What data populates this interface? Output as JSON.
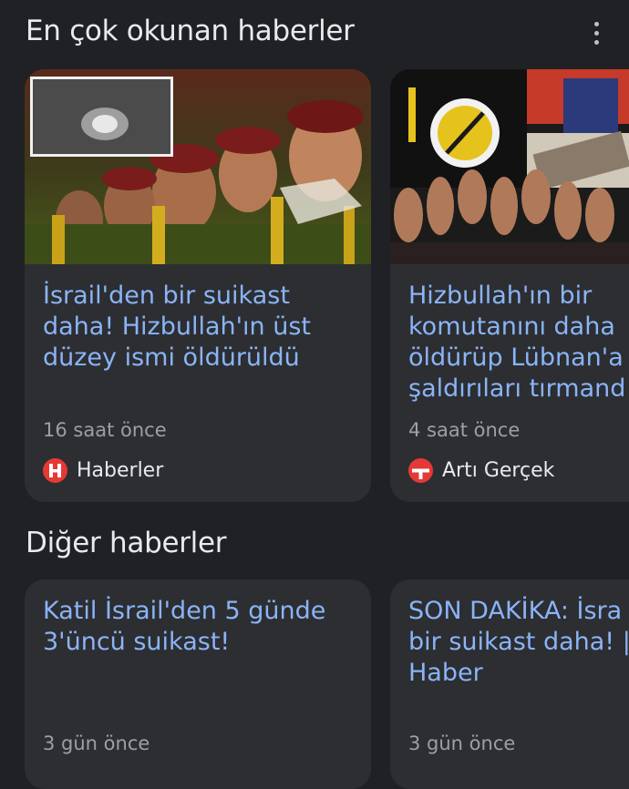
{
  "sections": {
    "top_news_title": "En çok okunan haberler",
    "other_news_title": "Diğer haberler"
  },
  "top_cards": [
    {
      "title": "İsrail'den bir suikast\ndaha! Hizbullah'ın üst\ndüzey ismi öldürüldü",
      "time": "16 saat önce",
      "source": "Haberler",
      "source_icon": "haberler-logo-icon",
      "source_color": "#e53935"
    },
    {
      "title": "Hizbullah'ın bir\nkomutanını daha\nöldürüp Lübnan'a\nşaldırıları tırmand",
      "time": "4 saat önce",
      "source": "Artı Gerçek",
      "source_icon": "arti-gercek-logo-icon",
      "source_color": "#e53935"
    }
  ],
  "other_cards": [
    {
      "title": "Katil İsrail'den 5 günde\n3'üncü suikast!",
      "time": "3 gün önce"
    },
    {
      "title": "SON DAKİKA: İsra\nbir suikast daha! |\nHaber",
      "time": "3 gün önce"
    }
  ],
  "colors": {
    "background": "#202124",
    "card": "#2d2e31",
    "link": "#8ab4f8",
    "muted": "#9aa0a6"
  }
}
